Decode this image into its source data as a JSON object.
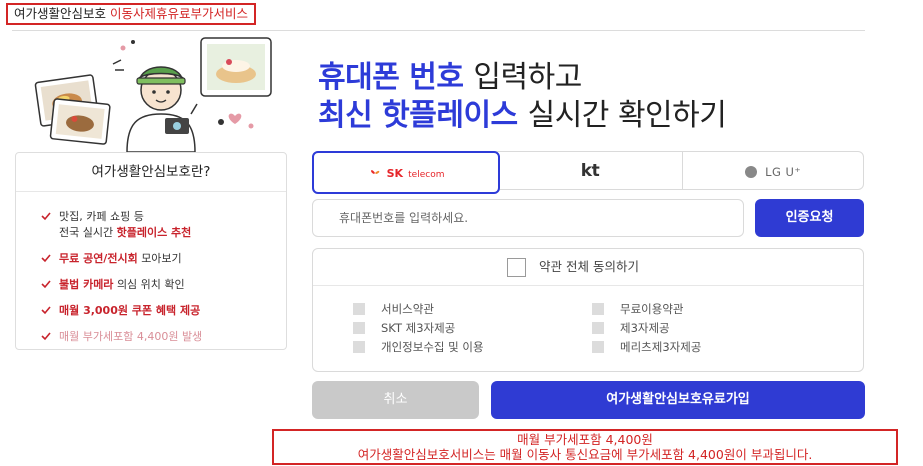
{
  "top_label": {
    "prefix": "여가생활안심보호",
    "suffix": "이동사제휴유료부가서비스"
  },
  "headline": {
    "line1_blue": "휴대폰 번호",
    "line1_dark": "입력하고",
    "line2_blue": "최신 핫플레이스",
    "line2_dark": "실시간 확인하기"
  },
  "info": {
    "title": "여가생활안심보호란?",
    "items": [
      {
        "line1": "맛집, 카페 쇼핑 등",
        "line2_plain": "전국 실시간",
        "line2_red": "핫플레이스 추천"
      },
      {
        "red": "무료 공연/전시회",
        "plain": "모아보기"
      },
      {
        "red": "불법 카메라",
        "plain": "의심 위치 확인"
      },
      {
        "red": "매월 3,000원 쿠폰 혜택 제공"
      },
      {
        "pink": "매월 부가세포함 4,400원 발생"
      }
    ]
  },
  "carriers": {
    "sk_brand": "SK",
    "sk_sub": "telecom",
    "kt": "kt",
    "lg": "LG U⁺"
  },
  "phone": {
    "placeholder": "휴대폰번호를 입력하세요.",
    "auth_button": "인증요청"
  },
  "terms": {
    "all": "약관 전체 동의하기",
    "left": [
      "서비스약관",
      "SKT 제3자제공",
      "개인정보수집 및 이용"
    ],
    "right": [
      "무료이용약관",
      "제3자제공",
      "메리츠제3자제공"
    ]
  },
  "buttons": {
    "cancel": "취소",
    "join": "여가생활안심보호유료가입"
  },
  "notice": {
    "line1": "매월 부가세포함 4,400원",
    "line2": "여가생활안심보호서비스는 매월 이동사 통신요금에 부가세포함 4,400원이 부과됩니다."
  },
  "colors": {
    "accent": "#2f3bd3",
    "red": "#d32525",
    "disabled": "#c9c9c9"
  }
}
